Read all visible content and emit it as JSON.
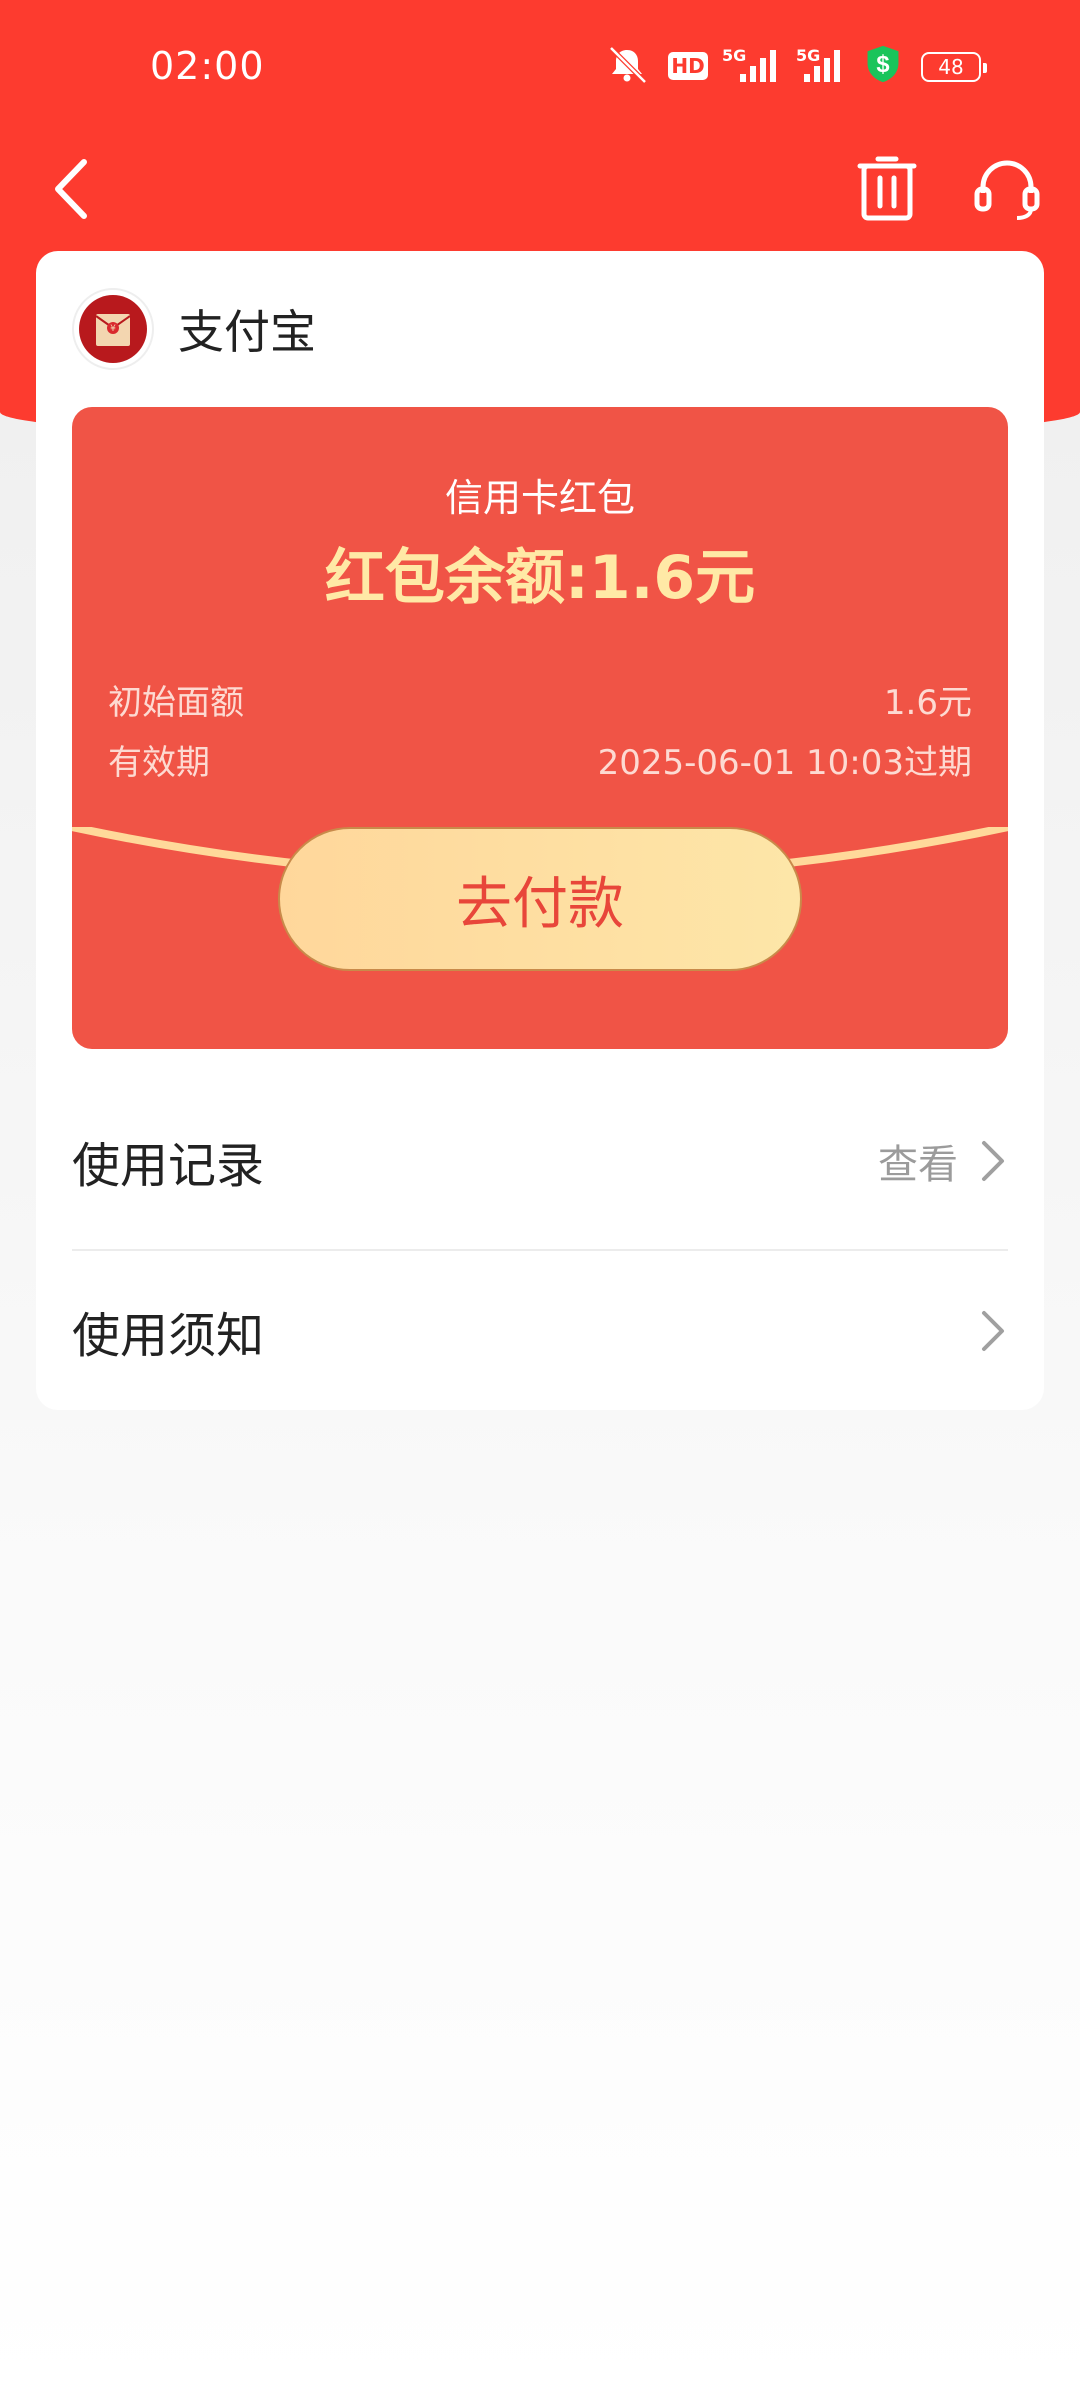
{
  "status_bar": {
    "time": "02:00",
    "battery": "48",
    "net1": "5G",
    "net2": "5G",
    "hd": "HD"
  },
  "nav": {
    "back_icon": "chevron-left-icon",
    "delete_icon": "trash-icon",
    "support_icon": "headset-icon"
  },
  "merchant": {
    "name": "支付宝",
    "avatar_icon": "red-envelope-icon"
  },
  "red_packet": {
    "title": "信用卡红包",
    "balance": "红包余额:1.6元",
    "initial_label": "初始面额",
    "initial_value": "1.6元",
    "validity_label": "有效期",
    "validity_value": "2025-06-01 10:03过期",
    "pay_label": "去付款"
  },
  "rows": [
    {
      "label": "使用记录",
      "action": "查看"
    },
    {
      "label": "使用须知",
      "action": ""
    }
  ],
  "colors": {
    "brand_red": "#fd3b2f",
    "packet_red": "#f05446",
    "gold": "#ffe9a6"
  }
}
